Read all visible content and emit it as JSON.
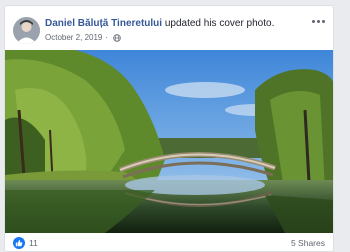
{
  "post": {
    "author_name": "Daniel Băluță Tineretului",
    "action_text": " updated his cover photo.",
    "timestamp": "October 2, 2019",
    "privacy_sep": "·",
    "privacy_icon": "globe-icon",
    "more_icon": "more-options-icon"
  },
  "engagement": {
    "reaction_icon": "like-icon",
    "reaction_count": "11",
    "shares_text": "5 Shares"
  },
  "colors": {
    "author_link": "#365899",
    "like_blue": "#1877f2",
    "meta_gray": "#616770"
  }
}
